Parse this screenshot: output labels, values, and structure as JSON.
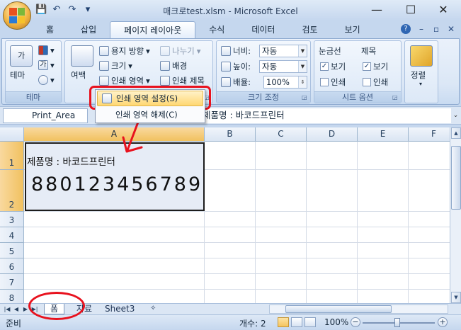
{
  "window": {
    "title": "매크로test.xlsm - Microsoft Excel",
    "minimize_icon": "—",
    "maximize_icon": "☐",
    "close_icon": "✕",
    "ribbon_min_icon": "–",
    "restore_icon": "▫",
    "ribbon_close_icon": "✕"
  },
  "quick_access": {
    "save_icon": "💾",
    "undo_icon": "↶",
    "redo_icon": "↷",
    "customize_icon": "▾"
  },
  "tabs": [
    "홈",
    "삽입",
    "페이지 레이아웃",
    "수식",
    "데이터",
    "검토",
    "보기"
  ],
  "active_tab": "페이지 레이아웃",
  "help_icon": "?",
  "ribbon": {
    "theme": {
      "label": "테마",
      "colors_letter": "가",
      "fonts_letter": "가",
      "group_label": "테마"
    },
    "page_setup": {
      "margins_label": "여백",
      "orientation_label": "용지 방향",
      "size_label": "크기",
      "print_area_label": "인쇄 영역",
      "breaks_label": "나누기",
      "background_label": "배경",
      "print_titles_label": "인쇄 제목"
    },
    "scale": {
      "width_label": "너비:",
      "width_value": "자동",
      "height_label": "높이:",
      "height_value": "자동",
      "scale_label": "배율:",
      "scale_value": "100%",
      "group_label": "크기 조정"
    },
    "sheet_options": {
      "gridlines_label": "눈금선",
      "headings_label": "제목",
      "view_label": "보기",
      "print_label": "인쇄",
      "check": "✓",
      "group_label": "시트 옵션"
    },
    "arrange": {
      "label": "정렬"
    }
  },
  "dropdown_menu": {
    "items": [
      "인쇄 영역 설정(S)",
      "인쇄 영역 해제(C)"
    ]
  },
  "formula_bar": {
    "name_box": "Print_Area",
    "content": "제품명 : 바코드프린터"
  },
  "columns": [
    "A",
    "B",
    "C",
    "D",
    "E",
    "F"
  ],
  "rows": [
    "1",
    "2",
    "3",
    "4",
    "5",
    "6",
    "7",
    "8"
  ],
  "cells": {
    "A1": "제품명 : 바코드프린터",
    "A2": "880123456789"
  },
  "sheet_tabs": [
    "폼",
    "자료",
    "Sheet3"
  ],
  "nav_icons": [
    "|◀",
    "◀",
    "▶",
    "▶|"
  ],
  "status": {
    "ready": "준비",
    "count": "개수: 2",
    "zoom": "100%",
    "zoom_out": "−",
    "zoom_in": "+"
  },
  "annotation_color": "#e8121e"
}
